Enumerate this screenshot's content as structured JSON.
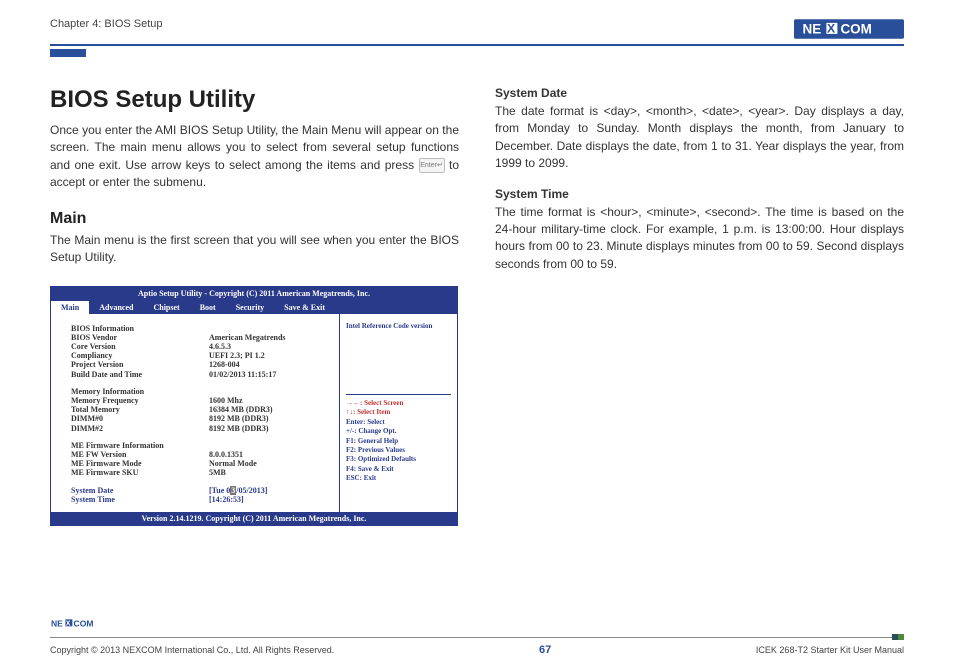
{
  "header": {
    "chapter": "Chapter 4: BIOS Setup",
    "logo_alt": "NEXCOM"
  },
  "left": {
    "title": "BIOS Setup Utility",
    "intro_a": "Once you enter the AMI BIOS Setup Utility, the Main Menu will appear on the screen. The main menu allows you to select from several setup functions and one exit. Use arrow keys to select among the items and press ",
    "intro_b": " to accept or enter the submenu.",
    "main_heading": "Main",
    "main_para": "The Main menu is the first screen that you will see when you enter the BIOS Setup Utility."
  },
  "right": {
    "sysdate_heading": "System Date",
    "sysdate_para": "The date format is <day>, <month>, <date>, <year>. Day displays a day, from Monday to Sunday. Month displays the month, from January to December. Date displays the date, from 1 to 31. Year displays the year, from 1999 to 2099.",
    "systime_heading": "System Time",
    "systime_para": "The time format is <hour>, <minute>, <second>. The time is based on the 24-hour military-time clock. For example, 1 p.m. is 13:00:00. Hour displays hours from 00 to 23. Minute displays minutes from 00 to 59. Second displays seconds from 00 to 59."
  },
  "bios": {
    "top": "Aptio Setup Utility - Copyright (C) 2011 American Megatrends, Inc.",
    "tabs": [
      "Main",
      "Advanced",
      "Chipset",
      "Boot",
      "Security",
      "Save & Exit"
    ],
    "selected_tab": "Main",
    "right_top": "Intel Reference Code version",
    "rows": [
      [
        "BIOS Information",
        ""
      ],
      [
        "BIOS Vendor",
        "American Megatrends"
      ],
      [
        "Core Version",
        "4.6.5.3"
      ],
      [
        "Compliancy",
        "UEFI 2.3; PI 1.2"
      ],
      [
        "Project Version",
        "1268-004"
      ],
      [
        "Build Date and Time",
        "01/02/2013 11:15:17"
      ]
    ],
    "mem_rows": [
      [
        "Memory Information",
        ""
      ],
      [
        "Memory Frequency",
        "1600 Mhz"
      ],
      [
        "Total Memory",
        "16384 MB (DDR3)"
      ],
      [
        "DIMM#0",
        "8192 MB (DDR3)"
      ],
      [
        "DIMM#2",
        "8192 MB (DDR3)"
      ]
    ],
    "me_rows": [
      [
        "ME Firmware Information",
        ""
      ],
      [
        "ME FW Version",
        "8.0.0.1351"
      ],
      [
        "ME Firmware Mode",
        "Normal Mode"
      ],
      [
        "ME Firmware SKU",
        "5MB"
      ]
    ],
    "editable": [
      [
        "System Date",
        "[Tue 0",
        "/05/2013]"
      ],
      [
        "System Time",
        "[14:26:53]",
        ""
      ]
    ],
    "help": {
      "l1": "→←: Select Screen",
      "l2": "↑↓: Select Item",
      "l3": "Enter: Select",
      "l4": "+/-: Change Opt.",
      "l5": "F1: General Help",
      "l6": "F2: Previous Values",
      "l7": "F3: Optimized Defaults",
      "l8": "F4: Save & Exit",
      "l9": "ESC: Exit"
    },
    "bottom": "Version 2.14.1219. Copyright (C) 2011 American Megatrends, Inc."
  },
  "footer": {
    "copyright": "Copyright © 2013 NEXCOM International Co., Ltd. All Rights Reserved.",
    "page": "67",
    "product": "ICEK 268-T2 Starter Kit User Manual"
  }
}
